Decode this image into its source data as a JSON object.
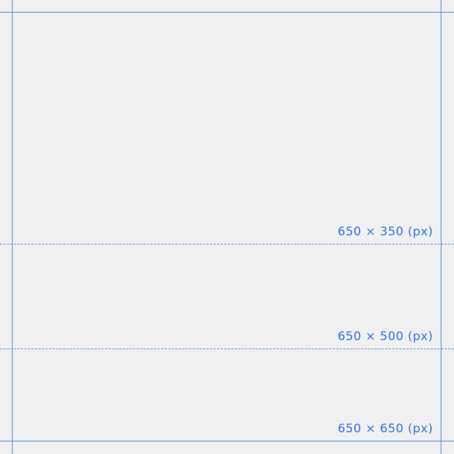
{
  "colors": {
    "background": "#f0f0f0",
    "guide": "#4a88e8",
    "label": "#2f74e0"
  },
  "markers": [
    {
      "label": "650 × 350 (px)",
      "line_style": "dashed"
    },
    {
      "label": "650 × 500 (px)",
      "line_style": "dashed"
    },
    {
      "label": "650 × 650 (px)",
      "line_style": "solid"
    }
  ]
}
